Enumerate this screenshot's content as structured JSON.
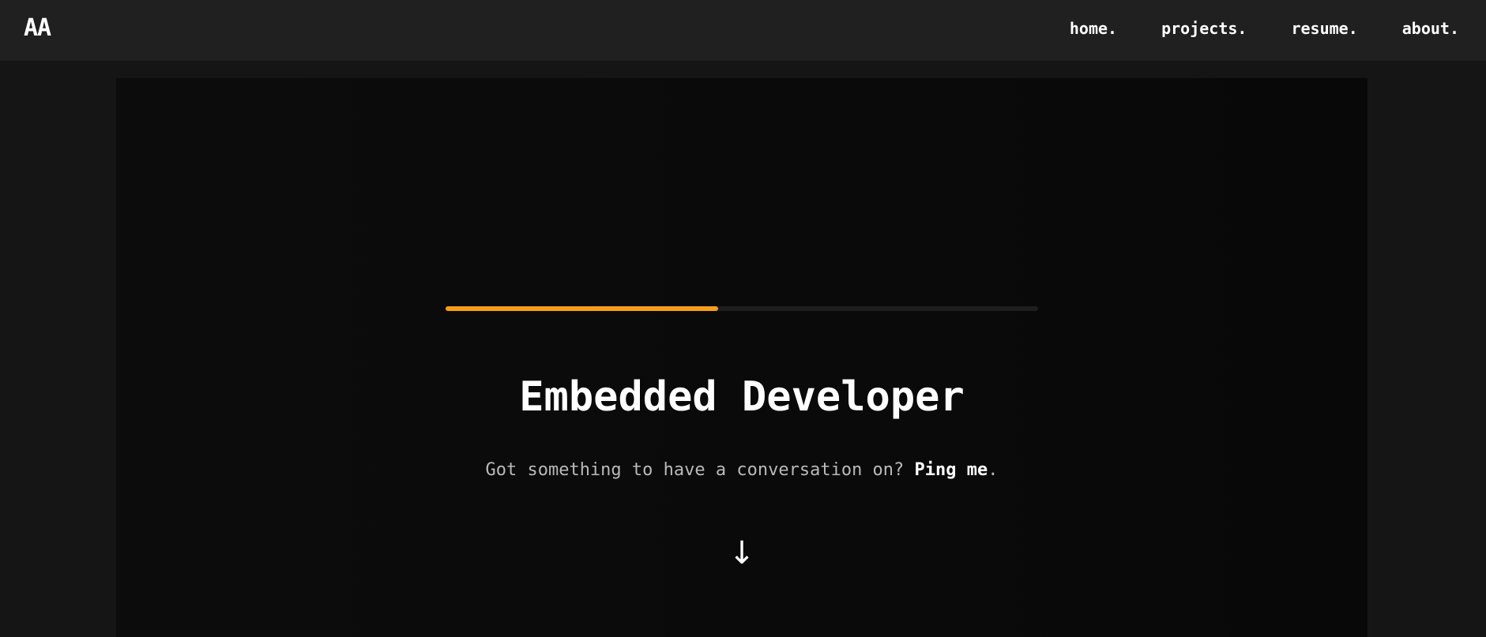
{
  "header": {
    "logo": "AA",
    "nav": [
      {
        "label": "home."
      },
      {
        "label": "projects."
      },
      {
        "label": "resume."
      },
      {
        "label": "about."
      }
    ]
  },
  "hero": {
    "progress_fraction": 0.46,
    "progress_color": "#f59e1b",
    "title": "Embedded Developer",
    "subtitle_prefix": "Got something to have a conversation on? ",
    "ping_link": "Ping me",
    "subtitle_suffix": ".",
    "scroll_arrow": "↓",
    "scroll_icon": "arrow-down-icon"
  }
}
